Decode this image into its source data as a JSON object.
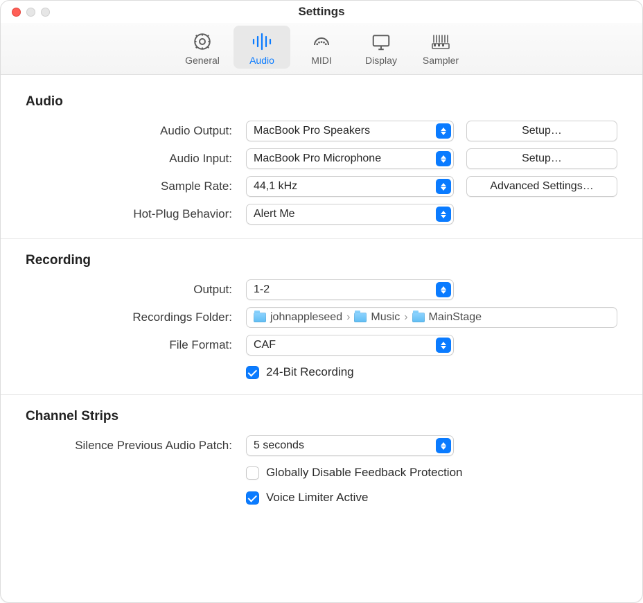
{
  "window": {
    "title": "Settings"
  },
  "toolbar": {
    "items": [
      {
        "label": "General"
      },
      {
        "label": "Audio"
      },
      {
        "label": "MIDI"
      },
      {
        "label": "Display"
      },
      {
        "label": "Sampler"
      }
    ],
    "selected_index": 1
  },
  "sections": {
    "audio": {
      "title": "Audio",
      "output_label": "Audio Output:",
      "output_value": "MacBook Pro Speakers",
      "output_setup_label": "Setup…",
      "input_label": "Audio Input:",
      "input_value": "MacBook Pro Microphone",
      "input_setup_label": "Setup…",
      "sample_rate_label": "Sample Rate:",
      "sample_rate_value": "44,1 kHz",
      "advanced_label": "Advanced Settings…",
      "hotplug_label": "Hot-Plug Behavior:",
      "hotplug_value": "Alert Me"
    },
    "recording": {
      "title": "Recording",
      "output_label": "Output:",
      "output_value": "1-2",
      "folder_label": "Recordings Folder:",
      "folder_path": [
        "johnappleseed",
        "Music",
        "MainStage"
      ],
      "file_format_label": "File Format:",
      "file_format_value": "CAF",
      "bit24_label": "24-Bit Recording",
      "bit24_checked": true
    },
    "channel_strips": {
      "title": "Channel Strips",
      "silence_label": "Silence Previous Audio Patch:",
      "silence_value": "5 seconds",
      "feedback_label": "Globally Disable Feedback Protection",
      "feedback_checked": false,
      "voice_limiter_label": "Voice Limiter Active",
      "voice_limiter_checked": true
    }
  }
}
